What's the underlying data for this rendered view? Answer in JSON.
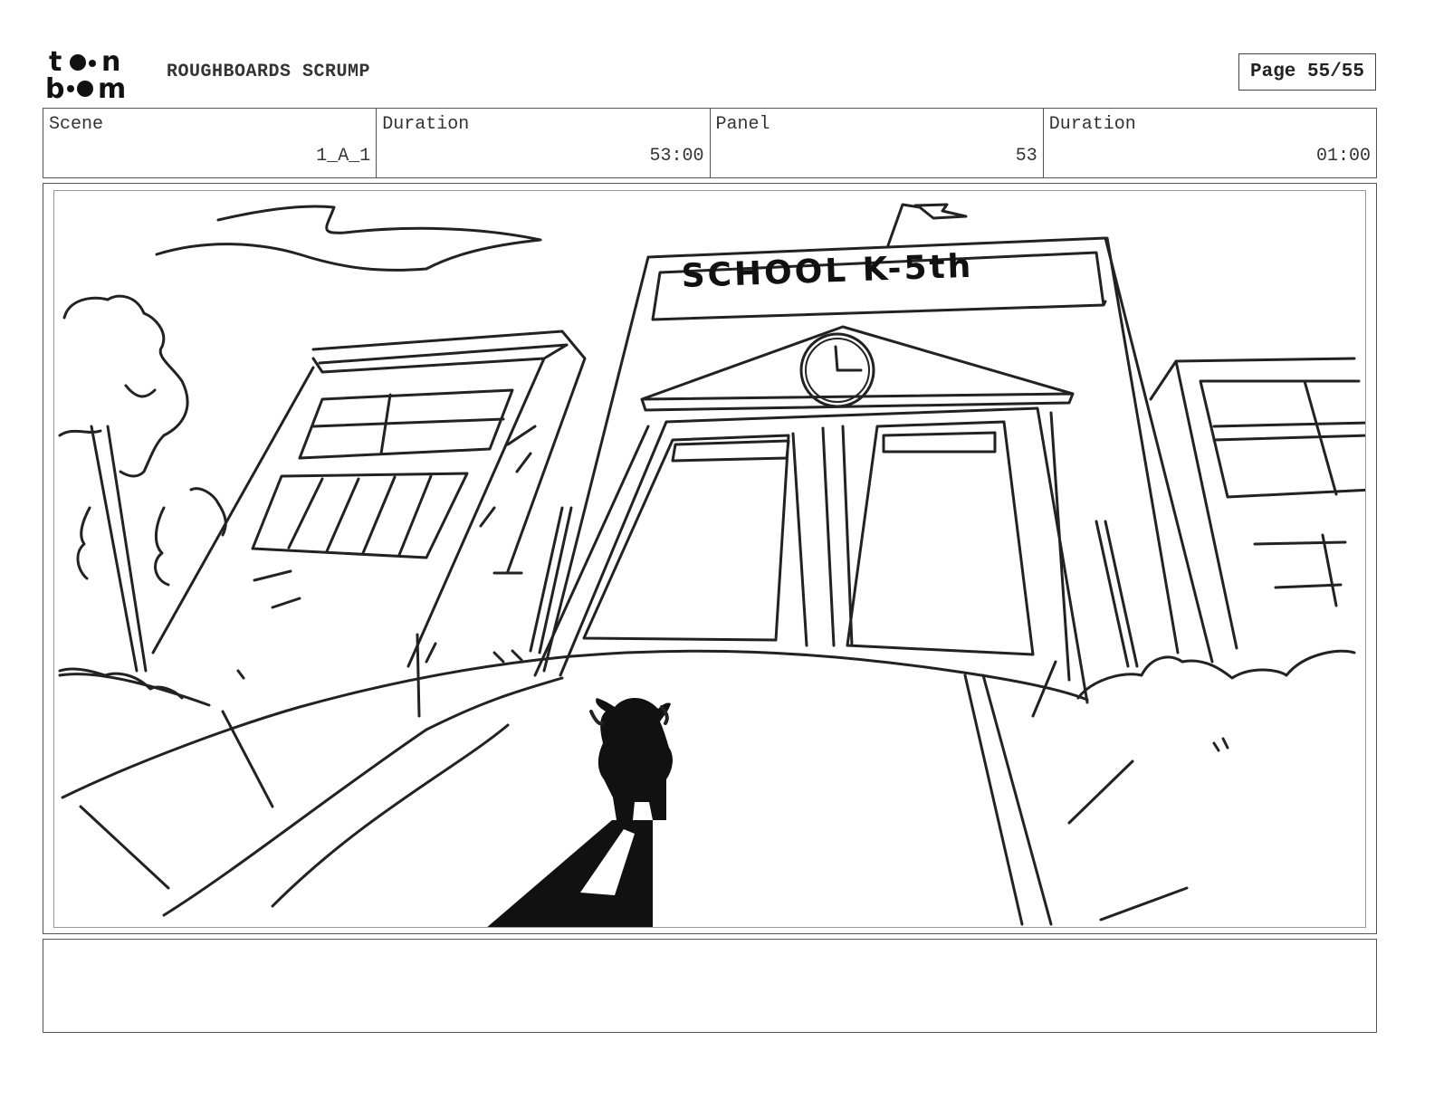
{
  "header": {
    "logo_text": "toon boom",
    "project_title": "ROUGHBOARDS SCRUMP",
    "page_label": "Page 55/55"
  },
  "info": {
    "scene_label": "Scene",
    "scene_value": "1_A_1",
    "scene_duration_label": "Duration",
    "scene_duration_value": "53:00",
    "panel_label": "Panel",
    "panel_value": "53",
    "panel_duration_label": "Duration",
    "panel_duration_value": "01:00"
  },
  "drawing": {
    "sign_text": "SCHOOL K-5th"
  },
  "notes": {
    "text": ""
  }
}
